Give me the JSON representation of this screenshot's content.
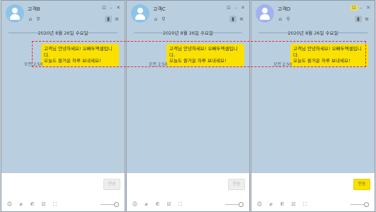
{
  "windows": [
    {
      "contact_name": "고객B",
      "date_divider": "2020년 8월 26일 수요일",
      "time": "오전 2:50",
      "send_label": "전송"
    },
    {
      "contact_name": "고객C",
      "date_divider": "2020년 8월 26일 수요일",
      "time": "오전 2:50",
      "send_label": "전송"
    },
    {
      "contact_name": "고객D",
      "date_divider": "2020년 8월 26일 수요일",
      "time": "오전 2:50",
      "send_label": "전송"
    }
  ],
  "message": {
    "line1": "고객님 안녕하세요! 오빠두엑셀입니",
    "line2": "다.",
    "line3": "오늘도 즐거운 하루 보내세요!"
  },
  "icons": {
    "window_controls": [
      "pin-icon",
      "minimize-icon",
      "close-icon"
    ],
    "header_left": [
      "home-icon",
      "search-icon"
    ],
    "header_right": [
      "phone-icon",
      "menu-icon"
    ],
    "toolbar": [
      "emoji-icon",
      "attach-icon",
      "call-icon",
      "calendar-icon",
      "capture-icon"
    ]
  },
  "colors": {
    "chat_bg": "#b9cfe0",
    "bubble": "#fae100",
    "highlight_border": "#e8282b",
    "send_active": "#fae100"
  }
}
